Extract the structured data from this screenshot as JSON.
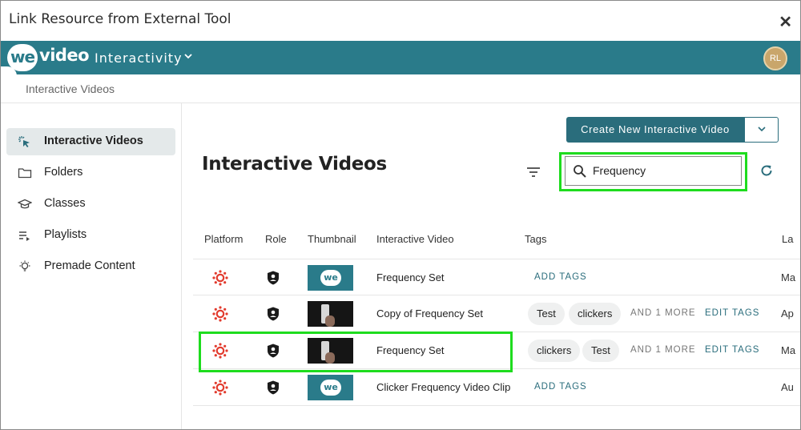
{
  "window": {
    "title": "Link Resource from External Tool",
    "close_glyph": "✕"
  },
  "appbar": {
    "logo_we": "we",
    "logo_video": "video",
    "product": "Interactivity",
    "avatar_initials": "RL"
  },
  "breadcrumb": {
    "current": "Interactive Videos"
  },
  "sidebar": {
    "items": [
      {
        "label": "Interactive Videos",
        "icon": "cursor-click-icon",
        "active": true
      },
      {
        "label": "Folders",
        "icon": "folder-icon"
      },
      {
        "label": "Classes",
        "icon": "graduation-cap-icon"
      },
      {
        "label": "Playlists",
        "icon": "playlist-icon"
      },
      {
        "label": "Premade Content",
        "icon": "lightbulb-icon"
      }
    ]
  },
  "main": {
    "title": "Interactive Videos",
    "create_button": "Create New Interactive Video",
    "search": {
      "value": "Frequency"
    }
  },
  "table": {
    "headers": {
      "platform": "Platform",
      "role": "Role",
      "thumbnail": "Thumbnail",
      "video": "Interactive Video",
      "tags": "Tags",
      "last": "La"
    },
    "rows": [
      {
        "name": "Frequency Set",
        "thumb": "we",
        "thumb_text": "we",
        "add_tags": "ADD TAGS",
        "last": "Ma"
      },
      {
        "name": "Copy of Frequency Set",
        "thumb": "dark",
        "tag1": "Test",
        "tag2": "clickers",
        "more": "AND 1 MORE",
        "edit_tags": "EDIT TAGS",
        "last": "Ap"
      },
      {
        "name": "Frequency Set",
        "thumb": "dark",
        "tag1": "clickers",
        "tag2": "Test",
        "more": "AND 1 MORE",
        "edit_tags": "EDIT TAGS",
        "last": "Ma"
      },
      {
        "name": "Clicker Frequency Video Clip",
        "thumb": "we",
        "thumb_text": "we",
        "add_tags": "ADD TAGS",
        "last": "Au"
      }
    ]
  },
  "colors": {
    "brand": "#2a7b8a",
    "button": "#2a6d7c",
    "highlight": "#1edc1e",
    "canvas_red": "#e23b2e"
  }
}
